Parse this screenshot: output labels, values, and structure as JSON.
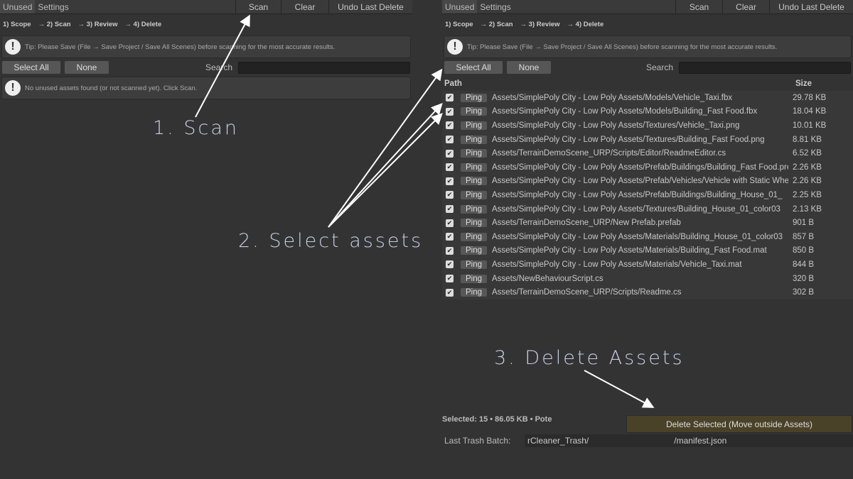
{
  "toolbar": {
    "tabs": [
      "Unused",
      "Settings"
    ],
    "scan": "Scan",
    "clear": "Clear",
    "undo": "Undo Last Delete"
  },
  "steps": [
    "1) Scope",
    "→ 2) Scan",
    "→ 3) Review",
    "→ 4) Delete"
  ],
  "tip": "Tip: Please Save (File → Save Project / Save All Scenes) before scanning for the most accurate results.",
  "select_all": "Select All",
  "none": "None",
  "search_label": "Search",
  "search_value": "",
  "empty_msg": "No unused assets found (or not scanned yet). Click Scan.",
  "table": {
    "path_header": "Path",
    "size_header": "Size",
    "ping": "Ping",
    "rows": [
      {
        "path": "Assets/SimplePoly City - Low Poly Assets/Models/Vehicle_Taxi.fbx",
        "size": "29.78 KB"
      },
      {
        "path": "Assets/SimplePoly City - Low Poly Assets/Models/Building_Fast Food.fbx",
        "size": "18.04 KB"
      },
      {
        "path": "Assets/SimplePoly City - Low Poly Assets/Textures/Vehicle_Taxi.png",
        "size": "10.01 KB"
      },
      {
        "path": "Assets/SimplePoly City - Low Poly Assets/Textures/Building_Fast Food.png",
        "size": "8.81 KB"
      },
      {
        "path": "Assets/TerrainDemoScene_URP/Scripts/Editor/ReadmeEditor.cs",
        "size": "6.52 KB"
      },
      {
        "path": "Assets/SimplePoly City - Low Poly Assets/Prefab/Buildings/Building_Fast Food.prefab",
        "size": "2.26 KB"
      },
      {
        "path": "Assets/SimplePoly City - Low Poly Assets/Prefab/Vehicles/Vehicle with Static Wheels",
        "size": "2.26 KB"
      },
      {
        "path": "Assets/SimplePoly City - Low Poly Assets/Prefab/Buildings/Building_House_01_",
        "size": "2.25 KB"
      },
      {
        "path": "Assets/SimplePoly City - Low Poly Assets/Textures/Building_House_01_color03",
        "size": "2.13 KB"
      },
      {
        "path": "Assets/TerrainDemoScene_URP/New Prefab.prefab",
        "size": "901 B"
      },
      {
        "path": "Assets/SimplePoly City - Low Poly Assets/Materials/Building_House_01_color03",
        "size": "857 B"
      },
      {
        "path": "Assets/SimplePoly City - Low Poly Assets/Materials/Building_Fast Food.mat",
        "size": "850 B"
      },
      {
        "path": "Assets/SimplePoly City - Low Poly Assets/Materials/Vehicle_Taxi.mat",
        "size": "844 B"
      },
      {
        "path": "Assets/NewBehaviourScript.cs",
        "size": "320 B"
      },
      {
        "path": "Assets/TerrainDemoScene_URP/Scripts/Readme.cs",
        "size": "302 B"
      }
    ]
  },
  "footer": {
    "selected": "Selected: 15  •  86.05 KB  •  Pote",
    "delete": "Delete Selected (Move outside Assets)",
    "trash_label": "Last Trash Batch:",
    "trash_value": "rCleaner_Trash/                                    /manifest.json"
  },
  "annotations": {
    "a1": "1.  Scan",
    "a2": "2. Select assets",
    "a3": "3. Delete Assets"
  }
}
